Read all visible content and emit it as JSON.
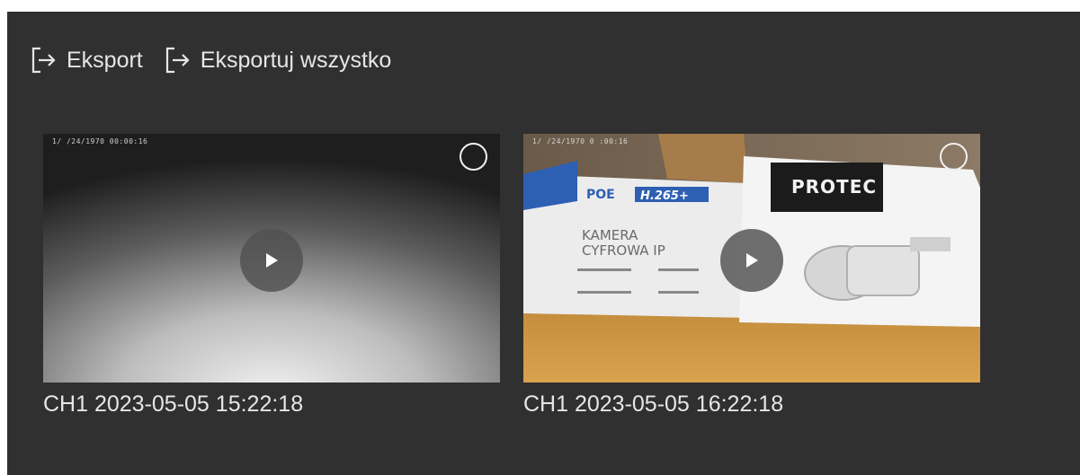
{
  "toolbar": {
    "export_label": "Eksport",
    "export_all_label": "Eksportuj wszystko"
  },
  "recordings": [
    {
      "osd": "1/ /24/1970  00:00:16",
      "caption": "CH1 2023-05-05 15:22:18"
    },
    {
      "osd": "1/ /24/1970  0 :00:16",
      "caption": "CH1 2023-05-05 16:22:18",
      "box_text": {
        "brand": "PROTEC",
        "poe": "POE",
        "codec": "H.265+",
        "line1": "KAMERA",
        "line2": "CYFROWA IP"
      }
    }
  ],
  "colors": {
    "panel": "#303030",
    "text": "#e6e6e6"
  }
}
